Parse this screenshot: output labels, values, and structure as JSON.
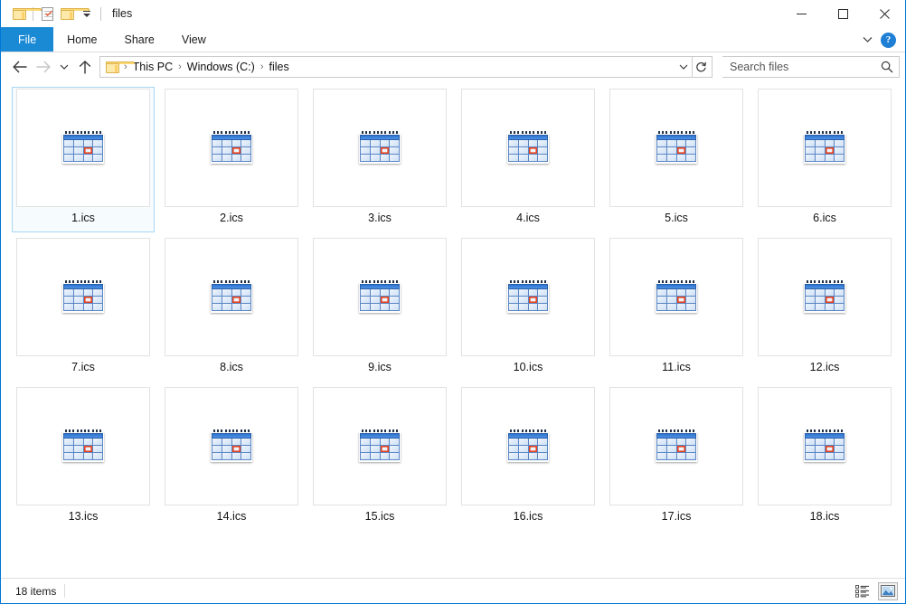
{
  "window": {
    "title": "files",
    "quick_access": [
      {
        "name": "folder-icon",
        "label": "Folder"
      },
      {
        "name": "properties-icon",
        "label": "Properties"
      },
      {
        "name": "new-folder-icon",
        "label": "New folder"
      },
      {
        "name": "customize-chevron-icon",
        "label": "Customize Quick Access Toolbar"
      }
    ],
    "controls": {
      "minimize": "—",
      "maximize": "☐",
      "close": "✕"
    }
  },
  "ribbon": {
    "tabs": [
      {
        "label": "File",
        "active": true
      },
      {
        "label": "Home",
        "active": false
      },
      {
        "label": "Share",
        "active": false
      },
      {
        "label": "View",
        "active": false
      }
    ],
    "expand_label": "˅",
    "help_label": "?"
  },
  "address": {
    "back_label": "←",
    "forward_label": "→",
    "recent_label": "˅",
    "up_label": "↑",
    "breadcrumbs": [
      "This PC",
      "Windows (C:)",
      "files"
    ],
    "separator": "›",
    "dropdown_label": "˅",
    "refresh_label": "↻"
  },
  "search": {
    "placeholder": "Search files",
    "value": ""
  },
  "files": [
    {
      "name": "1.ics",
      "type": "ics",
      "selected": true
    },
    {
      "name": "2.ics",
      "type": "ics",
      "selected": false
    },
    {
      "name": "3.ics",
      "type": "ics",
      "selected": false
    },
    {
      "name": "4.ics",
      "type": "ics",
      "selected": false
    },
    {
      "name": "5.ics",
      "type": "ics",
      "selected": false
    },
    {
      "name": "6.ics",
      "type": "ics",
      "selected": false
    },
    {
      "name": "7.ics",
      "type": "ics",
      "selected": false
    },
    {
      "name": "8.ics",
      "type": "ics",
      "selected": false
    },
    {
      "name": "9.ics",
      "type": "ics",
      "selected": false
    },
    {
      "name": "10.ics",
      "type": "ics",
      "selected": false
    },
    {
      "name": "11.ics",
      "type": "ics",
      "selected": false
    },
    {
      "name": "12.ics",
      "type": "ics",
      "selected": false
    },
    {
      "name": "13.ics",
      "type": "ics",
      "selected": false
    },
    {
      "name": "14.ics",
      "type": "ics",
      "selected": false
    },
    {
      "name": "15.ics",
      "type": "ics",
      "selected": false
    },
    {
      "name": "16.ics",
      "type": "ics",
      "selected": false
    },
    {
      "name": "17.ics",
      "type": "ics",
      "selected": false
    },
    {
      "name": "18.ics",
      "type": "ics",
      "selected": false
    }
  ],
  "status": {
    "item_count": "18 items",
    "views": [
      {
        "name": "details-view-button",
        "active": false
      },
      {
        "name": "large-icons-view-button",
        "active": true
      }
    ]
  },
  "colors": {
    "accent": "#0078d7",
    "file_tab": "#1b8ad4",
    "selection_border": "#a9d7f2",
    "calendar_blue": "#2f74d0",
    "calendar_highlight": "#e8431f",
    "folder_yellow": "#fde9a9"
  }
}
